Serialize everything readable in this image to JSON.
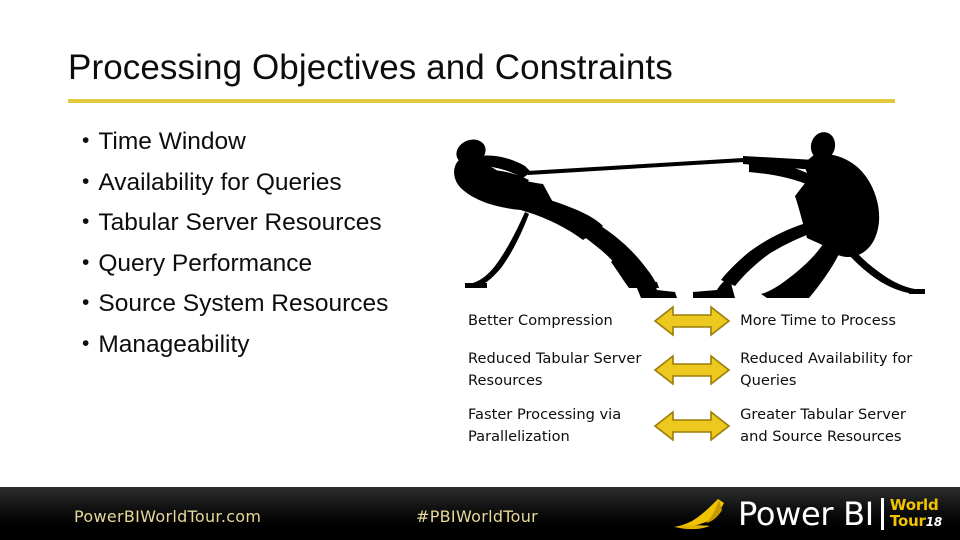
{
  "slide": {
    "title": "Processing Objectives and Constraints",
    "bullet_marker": "•",
    "bullets": [
      {
        "label": "Time Window"
      },
      {
        "label": "Availability for Queries"
      },
      {
        "label": "Tabular Server Resources"
      },
      {
        "label": "Query Performance"
      },
      {
        "label": "Source System Resources"
      },
      {
        "label": "Manageability"
      }
    ],
    "illustration": {
      "name": "tug-of-war-silhouette",
      "alt": "Two silhouetted figures pulling opposite ends of a rope in a tug of war"
    },
    "tradeoffs": [
      {
        "benefit": "Better Compression",
        "arrow": "double-headed-arrow",
        "cost": "More Time to Process"
      },
      {
        "benefit": "Reduced Tabular Server Resources",
        "arrow": "double-headed-arrow",
        "cost": "Reduced Availability for Queries"
      },
      {
        "benefit": "Faster Processing via Parallelization",
        "arrow": "double-headed-arrow",
        "cost": "Greater Tabular Server and Source Resources"
      }
    ]
  },
  "footer": {
    "url": "PowerBIWorldTour.com",
    "hashtag": "#PBIWorldTour",
    "logo": {
      "mark": "power-bi-sail-icon",
      "brand": "Power BI",
      "world": "World",
      "tour": "Tour",
      "year": "18"
    }
  },
  "colors": {
    "accent_gold": "#e2c93f",
    "arrow_fill": "#edc81f",
    "arrow_stroke": "#9a7d0a",
    "footer_text": "#e6d79a",
    "logo_yellow": "#f2c400",
    "text": "#0d0d0d"
  }
}
